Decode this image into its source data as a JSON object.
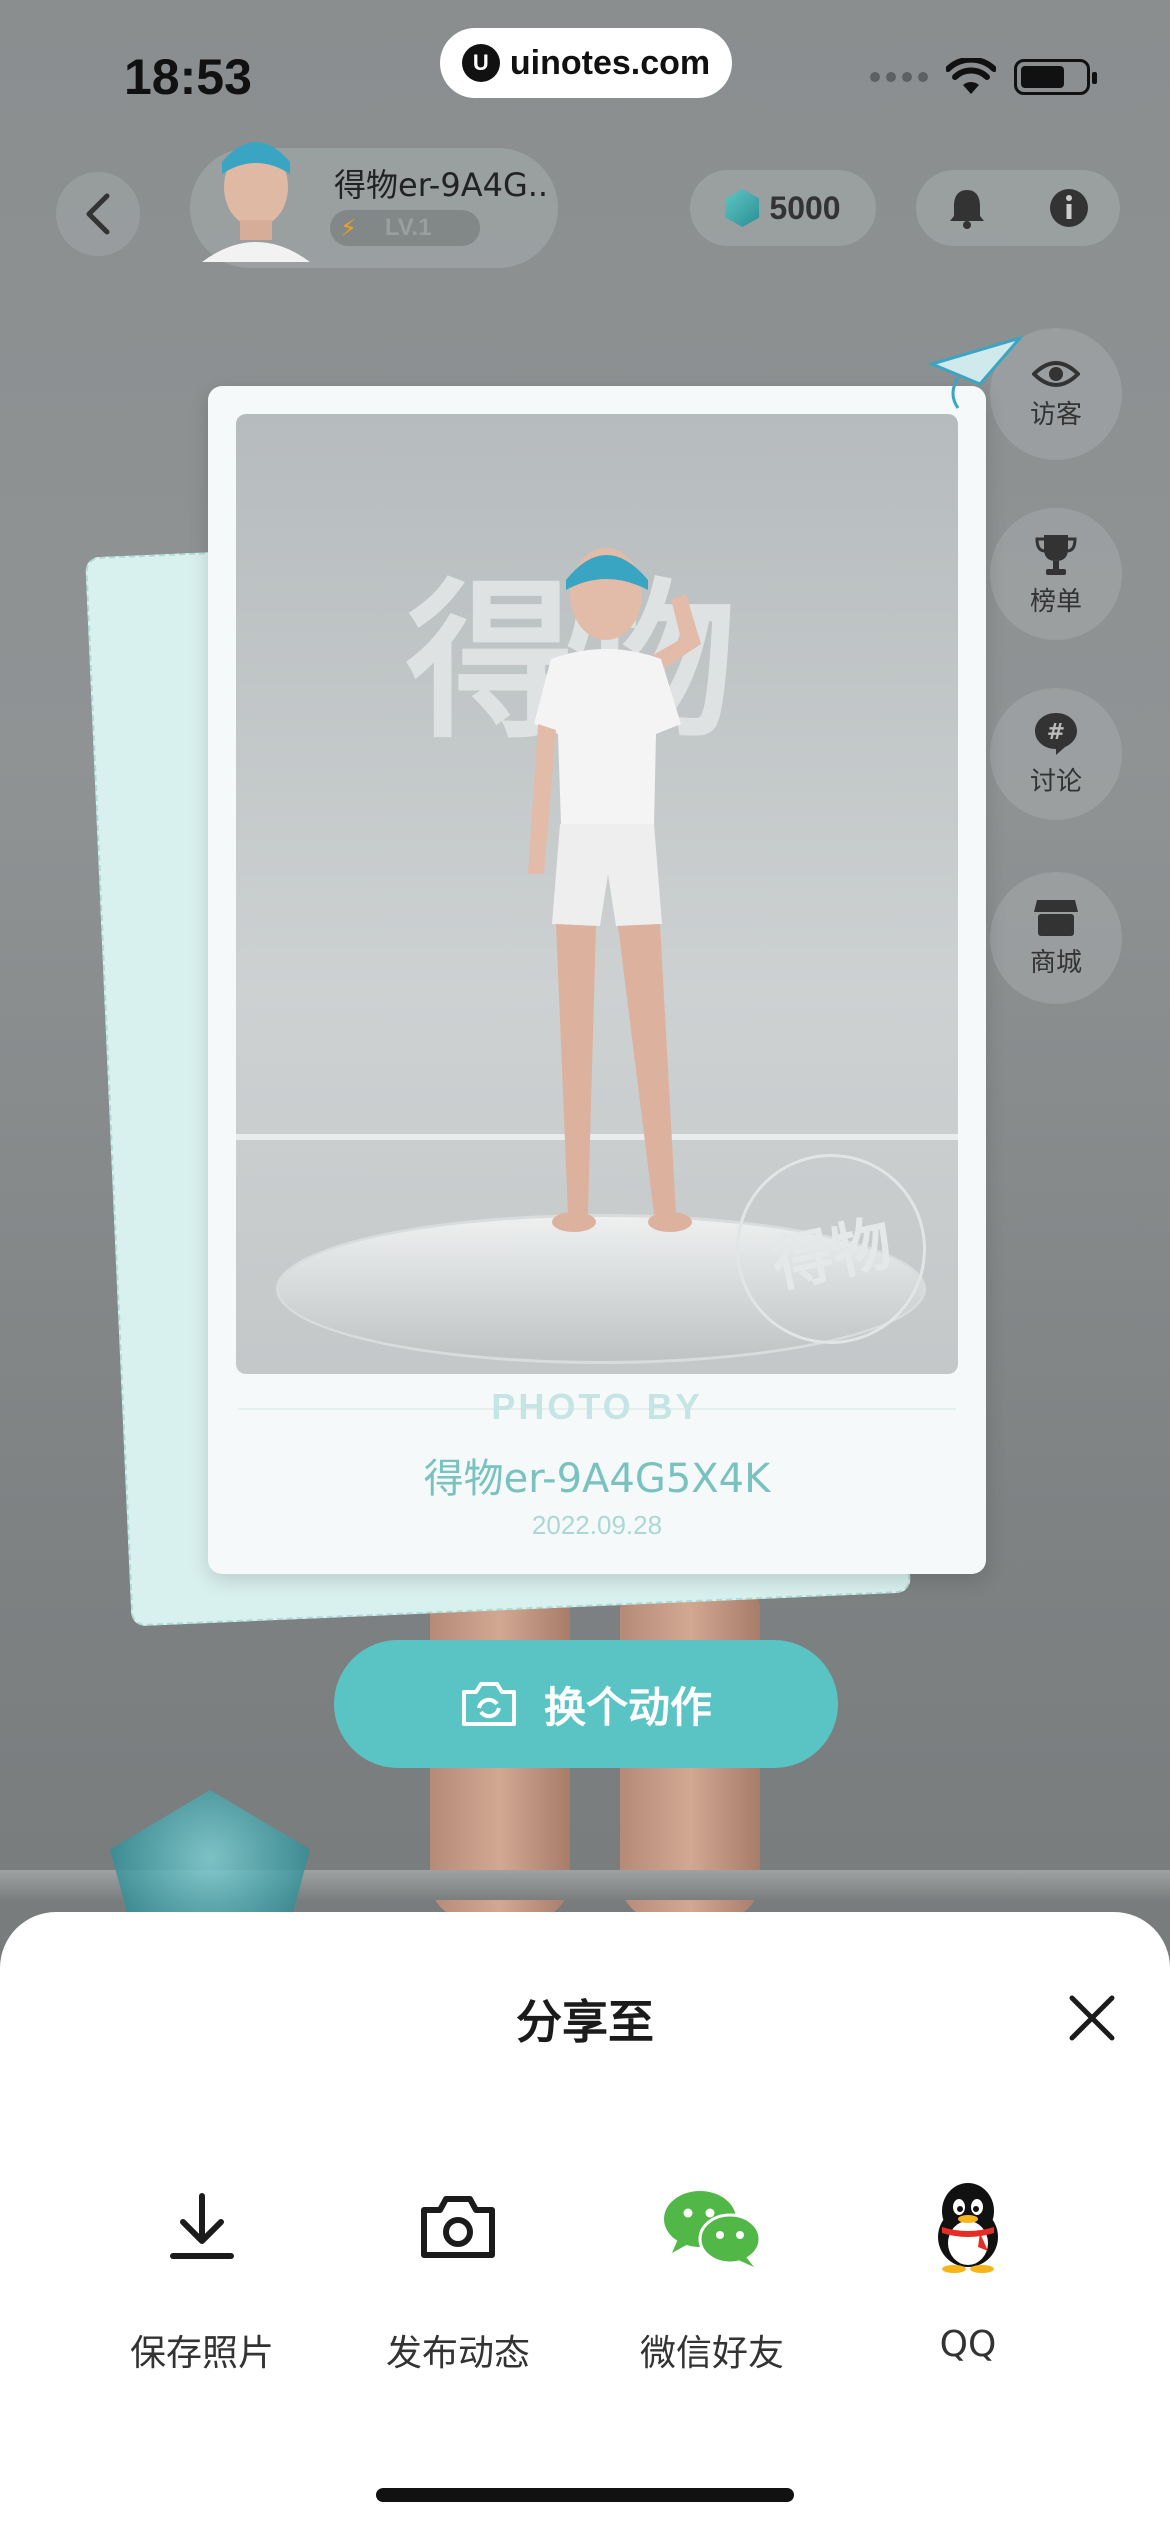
{
  "status_bar": {
    "time": "18:53",
    "url": "uinotes.com"
  },
  "header": {
    "username": "得物er-9A4G..",
    "level": "LV.1",
    "coins": "5000"
  },
  "side_menu": [
    {
      "label": "访客",
      "icon": "eye-icon"
    },
    {
      "label": "榜单",
      "icon": "trophy-icon"
    },
    {
      "label": "讨论",
      "icon": "hashtag-chat-icon"
    },
    {
      "label": "商城",
      "icon": "store-icon"
    }
  ],
  "photo_card": {
    "photo_by": "PHOTO BY",
    "user": "得物er-9A4G5X4K",
    "date": "2022.09.28"
  },
  "change_action": {
    "label": "换个动作"
  },
  "share_sheet": {
    "title": "分享至",
    "options": [
      {
        "label": "保存照片",
        "icon": "download-icon"
      },
      {
        "label": "发布动态",
        "icon": "camera-icon"
      },
      {
        "label": "微信好友",
        "icon": "wechat-icon"
      },
      {
        "label": "QQ",
        "icon": "qq-penguin-icon"
      }
    ]
  },
  "colors": {
    "accent": "#5ac4c4",
    "sheet_bg": "#ffffff",
    "card_text": "#79c2c0"
  }
}
